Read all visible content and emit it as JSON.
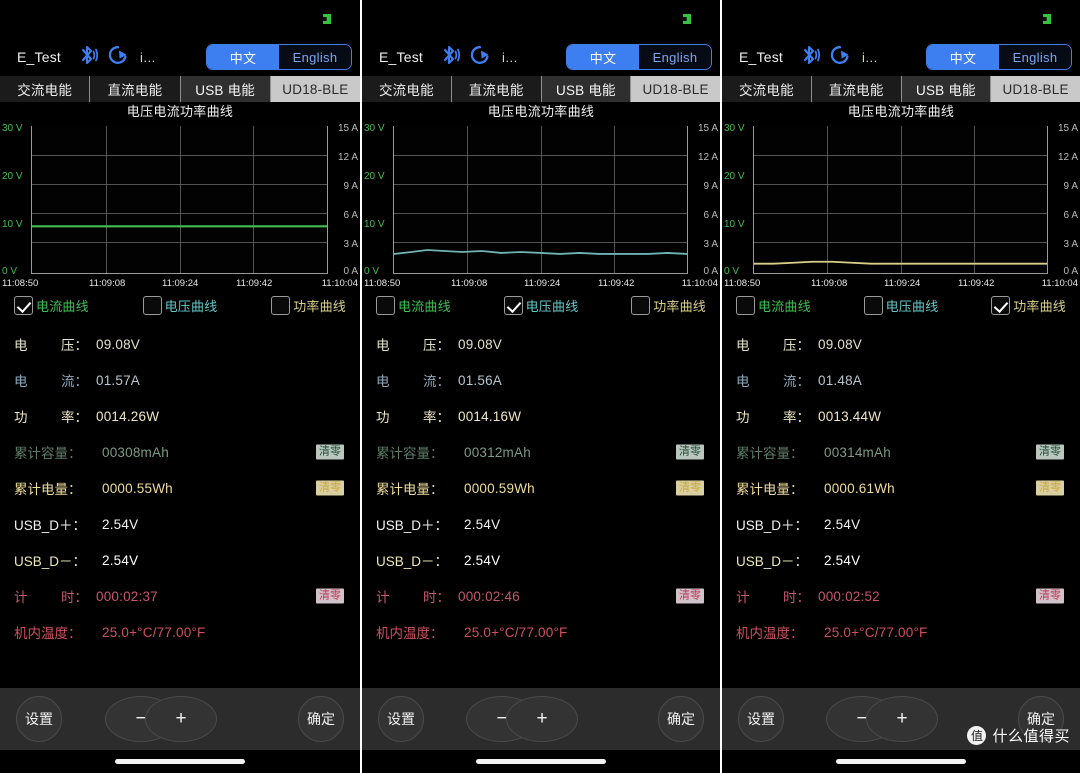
{
  "app": {
    "device_name": "E_Test",
    "overflow_label": "i...",
    "icons": {
      "bluetooth": "bluetooth-icon",
      "refresh": "refresh-icon",
      "badge": "green-status-badge"
    }
  },
  "language": {
    "active": "中文",
    "inactive": "English",
    "active_index": 0
  },
  "tabs": [
    {
      "label": "交流电能",
      "state": "dark"
    },
    {
      "label": "直流电能",
      "state": "dark"
    },
    {
      "label": "USB 电能",
      "state": "mid"
    },
    {
      "label": "UD18-BLE",
      "state": "light"
    }
  ],
  "chart_title": "电压电流功率曲线",
  "axis": {
    "y_left_ticks": [
      "30 V",
      "20 V",
      "10 V",
      "0 V"
    ],
    "y_right_ticks": [
      "15 A",
      "12 A",
      "9 A",
      "6 A",
      "3 A",
      "0 A"
    ],
    "x_ticks": [
      "11:08:50",
      "11:09:08",
      "11:09:24",
      "11:09:42",
      "11:10:04"
    ]
  },
  "legend": [
    {
      "label": "电流曲线",
      "color": "#3fbf52"
    },
    {
      "label": "电压曲线",
      "color": "#63c6c6"
    },
    {
      "label": "功率曲线",
      "color": "#d8d08a"
    }
  ],
  "labels": {
    "voltage": {
      "a": "电",
      "b": "压："
    },
    "current": {
      "a": "电",
      "b": "流："
    },
    "power": {
      "a": "功",
      "b": "率："
    },
    "capacity": "累计容量：",
    "energy": "累计电量：",
    "usb_dp": "USB_D＋：",
    "usb_dm": "USB_D－：",
    "timer": {
      "a": "计",
      "b": "时："
    },
    "temperature": "机内温度：",
    "reset": "清零"
  },
  "colors": {
    "voltage": "#e2e2c8",
    "current": "#b9c7cf",
    "power": "#efe7c4",
    "capacity": "#7d9a87",
    "energy": "#efdd9a",
    "usb_dp": "#f2f2f2",
    "usb_dm": "#ebe7b6",
    "timer": "#c7566f",
    "temperature": "#cf4f5e",
    "accent_blue": "#3d7ef1",
    "green": "#3fbf52",
    "cyan": "#63c6c6",
    "yellow": "#d8d08a"
  },
  "bottom_bar": {
    "settings": "设置",
    "minus": "−",
    "plus": "+",
    "confirm": "确定"
  },
  "watermark": {
    "logo": "值",
    "text": "什么值得买"
  },
  "panels": [
    {
      "checked_index": 0,
      "values": {
        "voltage": "09.08V",
        "current": "01.57A",
        "power": "0014.26W",
        "capacity": "00308mAh",
        "energy": "0000.55Wh",
        "usb_dp": "2.54V",
        "usb_dm": "2.54V",
        "timer": "000:02:37",
        "temperature": "25.0+°C/77.00°F"
      }
    },
    {
      "checked_index": 1,
      "values": {
        "voltage": "09.08V",
        "current": "01.56A",
        "power": "0014.16W",
        "capacity": "00312mAh",
        "energy": "0000.59Wh",
        "usb_dp": "2.54V",
        "usb_dm": "2.54V",
        "timer": "000:02:46",
        "temperature": "25.0+°C/77.00°F"
      }
    },
    {
      "checked_index": 2,
      "values": {
        "voltage": "09.08V",
        "current": "01.48A",
        "power": "0013.44W",
        "capacity": "00314mAh",
        "energy": "0000.61Wh",
        "usb_dp": "2.54V",
        "usb_dm": "2.54V",
        "timer": "000:02:52",
        "temperature": "25.0+°C/77.00°F"
      }
    }
  ],
  "chart_data": [
    {
      "type": "line",
      "title": "电压电流功率曲线",
      "series_name": "电流曲线",
      "color": "#3fbf52",
      "xlabel": "",
      "ylabel_left": "V",
      "ylabel_right": "A",
      "ylim_left": [
        0,
        30
      ],
      "ylim_right": [
        0,
        15
      ],
      "grid": true,
      "x": [
        "11:08:50",
        "11:09:08",
        "11:09:24",
        "11:09:42",
        "11:10:04"
      ],
      "values": [
        9.08,
        9.08,
        9.08,
        9.08,
        9.08
      ]
    },
    {
      "type": "line",
      "title": "电压电流功率曲线",
      "series_name": "电压曲线",
      "color": "#63c6c6",
      "xlabel": "",
      "ylabel_left": "V",
      "ylabel_right": "A",
      "ylim_left": [
        0,
        30
      ],
      "ylim_right": [
        0,
        15
      ],
      "grid": true,
      "x": [
        "11:08:50",
        "11:09:08",
        "11:09:24",
        "11:09:42",
        "11:10:04"
      ],
      "values": [
        1.62,
        1.66,
        1.6,
        1.58,
        1.56
      ]
    },
    {
      "type": "line",
      "title": "电压电流功率曲线",
      "series_name": "功率曲线",
      "color": "#d8d08a",
      "xlabel": "",
      "ylabel_left": "V",
      "ylabel_right": "A",
      "ylim_left": [
        0,
        30
      ],
      "ylim_right": [
        0,
        15
      ],
      "grid": true,
      "x": [
        "11:08:50",
        "11:09:08",
        "11:09:24",
        "11:09:42",
        "11:10:04"
      ],
      "values": [
        0.45,
        0.5,
        0.45,
        0.42,
        0.42
      ]
    }
  ]
}
